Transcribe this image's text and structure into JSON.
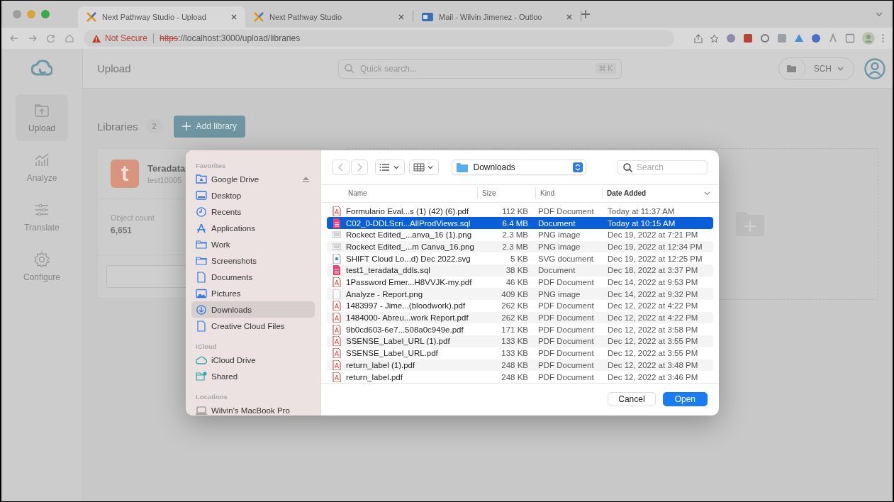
{
  "browser": {
    "tabs": [
      {
        "title": "Next Pathway Studio - Upload",
        "kind": "app",
        "selected": true
      },
      {
        "title": "Next Pathway Studio",
        "kind": "app",
        "selected": false
      },
      {
        "title": "Mail - Wilvin Jimenez - Outloo",
        "kind": "mail",
        "selected": false
      }
    ],
    "address": {
      "security": "Not Secure",
      "scheme": "https",
      "rest": "://localhost:3000/upload/libraries"
    }
  },
  "app": {
    "nav": [
      {
        "label": "Upload",
        "kind": "upload",
        "selected": true
      },
      {
        "label": "Analyze",
        "kind": "analyze",
        "selected": false
      },
      {
        "label": "Translate",
        "kind": "translate",
        "selected": false
      },
      {
        "label": "Configure",
        "kind": "configure",
        "selected": false
      }
    ],
    "header": {
      "title": "Upload",
      "search_placeholder": "Quick search...",
      "shortcut": "⌘ K",
      "workspace": "SCH"
    },
    "libraries": {
      "title": "Libraries",
      "count": "2",
      "add_button": "Add library",
      "cards": [
        {
          "logo_letter": "t",
          "name": "Teradata",
          "id": "test10005",
          "stat_label": "Object count",
          "stat_value": "6,651"
        }
      ]
    }
  },
  "dialog": {
    "sidebar": [
      {
        "heading": "Favorites",
        "items": [
          {
            "label": "Google Drive",
            "kind": "drive",
            "selected": false,
            "eject": true
          },
          {
            "label": "Desktop",
            "kind": "desktop",
            "selected": false,
            "eject": false
          },
          {
            "label": "Recents",
            "kind": "recents",
            "selected": false,
            "eject": false
          },
          {
            "label": "Applications",
            "kind": "apps",
            "selected": false,
            "eject": false
          },
          {
            "label": "Work",
            "kind": "folder",
            "selected": false,
            "eject": false
          },
          {
            "label": "Screenshots",
            "kind": "folder",
            "selected": false,
            "eject": false
          },
          {
            "label": "Documents",
            "kind": "document",
            "selected": false,
            "eject": false
          },
          {
            "label": "Pictures",
            "kind": "pictures",
            "selected": false,
            "eject": false
          },
          {
            "label": "Downloads",
            "kind": "downloads",
            "selected": true,
            "eject": false
          },
          {
            "label": "Creative Cloud Files",
            "kind": "document",
            "selected": false,
            "eject": false
          }
        ]
      },
      {
        "heading": "iCloud",
        "items": [
          {
            "label": "iCloud Drive",
            "kind": "cloud",
            "selected": false,
            "eject": false
          },
          {
            "label": "Shared",
            "kind": "shared",
            "selected": false,
            "eject": false
          }
        ]
      },
      {
        "heading": "Locations",
        "items": [
          {
            "label": "Wilvin's MacBook Pro",
            "kind": "laptop",
            "selected": false,
            "eject": false
          }
        ]
      }
    ],
    "location": "Downloads",
    "search_placeholder": "Search",
    "columns": [
      {
        "label": "Name",
        "sorted": false
      },
      {
        "label": "Size",
        "sorted": false
      },
      {
        "label": "Kind",
        "sorted": false
      },
      {
        "label": "Date Added",
        "sorted": true
      }
    ],
    "files": [
      {
        "name": "Formulario Eval...s (1) (42) (6).pdf",
        "size": "112 KB",
        "file_type": "PDF Document",
        "date": "Today at 11:37 AM",
        "kind": "pdf",
        "selected": false
      },
      {
        "name": "C02_0-DDLScri...AllProdViews.sql",
        "size": "6.4 MB",
        "file_type": "Document",
        "date": "Today at 10:15 AM",
        "kind": "script",
        "selected": true
      },
      {
        "name": "Rockect Edited_...anva_16 (1).png",
        "size": "2.3 MB",
        "file_type": "PNG image",
        "date": "Dec 19, 2022 at 7:21 PM",
        "kind": "picture",
        "selected": false
      },
      {
        "name": "Rockect Edited_...m Canva_16.png",
        "size": "2.3 MB",
        "file_type": "PNG image",
        "date": "Dec 19, 2022 at 12:34 PM",
        "kind": "picture",
        "selected": false
      },
      {
        "name": "SHIFT Cloud Lo...d) Dec 2022.svg",
        "size": "5 KB",
        "file_type": "SVG document",
        "date": "Dec 19, 2022 at 12:25 PM",
        "kind": "vector",
        "selected": false
      },
      {
        "name": "test1_teradata_ddls.sql",
        "size": "38 KB",
        "file_type": "Document",
        "date": "Dec 18, 2022 at 3:37 PM",
        "kind": "script",
        "selected": false
      },
      {
        "name": "1Password Emer...H8VVJK-my.pdf",
        "size": "46 KB",
        "file_type": "PDF Document",
        "date": "Dec 14, 2022 at 9:53 PM",
        "kind": "pdf",
        "selected": false
      },
      {
        "name": "Analyze - Report.png",
        "size": "409 KB",
        "file_type": "PNG image",
        "date": "Dec 14, 2022 at 9:32 PM",
        "kind": "blank",
        "selected": false
      },
      {
        "name": "1483997 - Jime...(bloodwork).pdf",
        "size": "262 KB",
        "file_type": "PDF Document",
        "date": "Dec 12, 2022 at 4:22 PM",
        "kind": "pdf",
        "selected": false
      },
      {
        "name": "1484000- Abreu...work Report.pdf",
        "size": "262 KB",
        "file_type": "PDF Document",
        "date": "Dec 12, 2022 at 4:22 PM",
        "kind": "pdf",
        "selected": false
      },
      {
        "name": "9b0cd603-6e7...508a0c949e.pdf",
        "size": "171 KB",
        "file_type": "PDF Document",
        "date": "Dec 12, 2022 at 3:58 PM",
        "kind": "pdf",
        "selected": false
      },
      {
        "name": "SSENSE_Label_URL (1).pdf",
        "size": "133 KB",
        "file_type": "PDF Document",
        "date": "Dec 12, 2022 at 3:55 PM",
        "kind": "pdf",
        "selected": false
      },
      {
        "name": "SSENSE_Label_URL.pdf",
        "size": "133 KB",
        "file_type": "PDF Document",
        "date": "Dec 12, 2022 at 3:55 PM",
        "kind": "pdf",
        "selected": false
      },
      {
        "name": "return_label (1).pdf",
        "size": "248 KB",
        "file_type": "PDF Document",
        "date": "Dec 12, 2022 at 3:48 PM",
        "kind": "pdf",
        "selected": false
      },
      {
        "name": "return_label.pdf",
        "size": "248 KB",
        "file_type": "PDF Document",
        "date": "Dec 12, 2022 at 3:46 PM",
        "kind": "pdf",
        "selected": false
      }
    ],
    "buttons": [
      {
        "label": "Cancel",
        "default": false
      },
      {
        "label": "Open",
        "default": true
      }
    ]
  }
}
